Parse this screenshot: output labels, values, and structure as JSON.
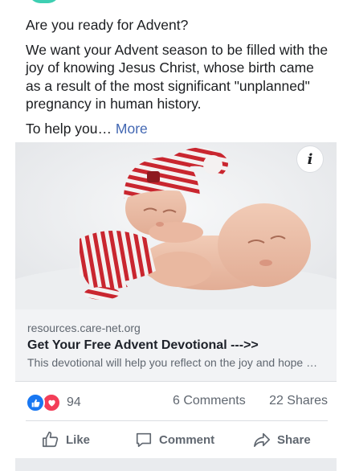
{
  "post": {
    "paragraphs": [
      "Are you ready for Advent?",
      "We want your Advent season to be filled with the joy of knowing Jesus Christ, whose birth came as a result of the most significant \"unplanned\" pregnancy in human history.",
      "To help you…"
    ],
    "more_label": "More"
  },
  "media": {
    "info_icon": "i",
    "image_icon": "sleeping-babies-photo"
  },
  "link": {
    "domain": "resources.care-net.org",
    "title": "Get Your Free Advent Devotional --->>",
    "description": "This devotional will help you reflect on the joy and hope of the Advent season..."
  },
  "stats": {
    "reaction_count": "94",
    "comments": "6 Comments",
    "shares": "22 Shares"
  },
  "actions": {
    "like": "Like",
    "comment": "Comment",
    "share": "Share"
  },
  "colors": {
    "link_blue": "#4267b2",
    "like_blue": "#1877f2",
    "love_red": "#f33e58",
    "muted_text": "#606770"
  }
}
